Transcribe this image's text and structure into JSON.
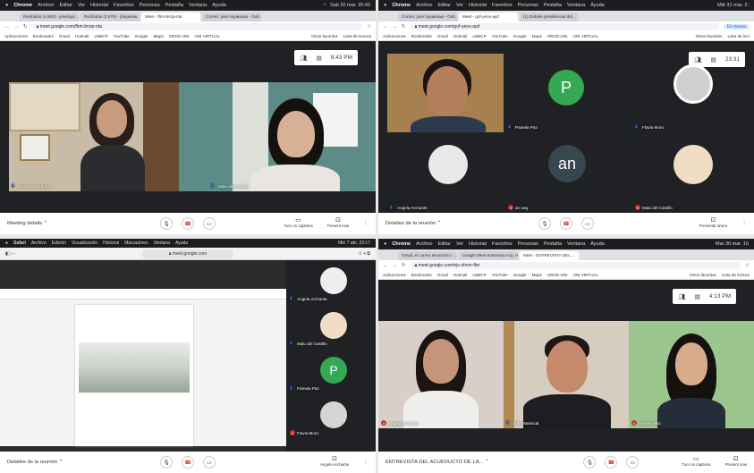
{
  "q1": {
    "menubar": [
      "Chrome",
      "Archivo",
      "Editar",
      "Ver",
      "Historial",
      "Favoritos",
      "Personas",
      "Pestaña",
      "Ventana",
      "Ayuda"
    ],
    "clock": "Sab 20 mar. 20:43",
    "tabs": [
      "Recibidos (4,860) - josehayc...",
      "Recibidos (2,578) - jhayakaw...",
      "Meet - fbm-bnzp-nta",
      "Correo: jose hayakawa - Outl..."
    ],
    "url": "meet.google.com/fbm-bnzp-nta",
    "bookmarks": [
      "Aplicaciones",
      "Bookmarks",
      "Gmail",
      "Hotmail",
      "viaBCP",
      "YouTube",
      "Google",
      "Maps",
      "ORCE-UNI",
      "UNI VIRTUAL"
    ],
    "bm_right": [
      "Otros favoritos",
      "Lista de lectura"
    ],
    "time": "8:43 PM",
    "p1": "Rodrigo Cordova",
    "p2": "Malu del Castillo",
    "meeting": "Meeting details",
    "captions": "Turn on captions",
    "present": "Present now"
  },
  "q2": {
    "clock": "Mié 31 mar. 2:",
    "tabs": [
      "Correo: jose hayakawa - Outl...",
      "Meet - gof-yeox-ayd",
      "(1) Debate presidencial del...",
      ""
    ],
    "url": "meet.google.com/gof-yeox-ayd",
    "time": "23:31",
    "paused": "En pausa",
    "bm_right": [
      "Otros favoritos",
      "Lista de lect"
    ],
    "p_letter": "P",
    "an_letter": "an",
    "names": [
      "Pamela Paz",
      "Flavia Muro",
      "Angela Archante",
      "an ueg",
      "Malu del Castillo"
    ],
    "meeting": "Detalles de la reunión",
    "present": "Presentar ahora"
  },
  "q3": {
    "menubar": [
      "Safari",
      "Archivo",
      "Edición",
      "Visualización",
      "Historial",
      "Marcadores",
      "Ventana",
      "Ayuda"
    ],
    "clock": "Mié 7 abr. 23:17",
    "url": "meet.google.com",
    "names": [
      "Angela Archante",
      "Malu del Castillo",
      "Pamela Paz",
      "Flavia Muro"
    ],
    "p_letter": "P",
    "meeting": "Detalles de la reunión",
    "presenter": "Angela Archante"
  },
  "q4": {
    "clock": "Mar 30 mar. 16",
    "tabs": [
      "Gmail, el correo electrónico ...",
      "Google Meet entrevista Acq. H...",
      "Meet - ENTREVISTA DEL ..."
    ],
    "url": "meet.google.com/ejs-ohcm-fbn",
    "time": "4:13 PM",
    "names": [
      "Angela Archante",
      "Gary Mariscal",
      "Pamela Paz"
    ],
    "meeting": "ENTREVISTA DEL ACUEDUCTO DE LA...",
    "captions": "Turn on captions",
    "present": "Present now"
  },
  "colors": {
    "meet_bg": "#202124",
    "end_call": "#d93025",
    "avatar_green": "#34a853",
    "avatar_dark": "#37474f"
  }
}
